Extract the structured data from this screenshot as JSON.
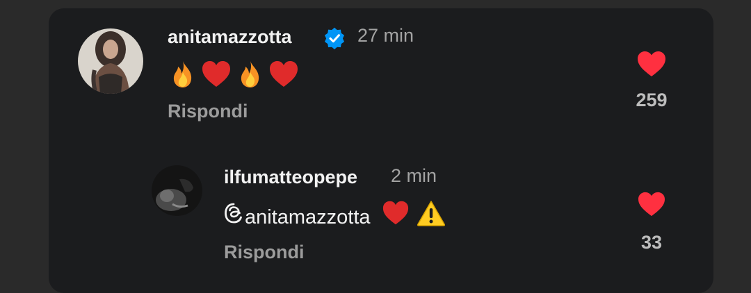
{
  "comments": [
    {
      "username": "anitamazzotta",
      "verified": true,
      "time": "27 min",
      "content_emojis": [
        "fire-emoji",
        "red-heart-emoji",
        "fire-emoji",
        "red-heart-emoji"
      ],
      "reply_label": "Rispondi",
      "like_count": "259"
    },
    {
      "username": "ilfumatteopepe",
      "verified": false,
      "time": "2 min",
      "mention": "anitamazzotta",
      "content_emojis": [
        "red-heart-emoji",
        "warning-emoji"
      ],
      "reply_label": "Rispondi",
      "like_count": "33"
    }
  ],
  "colors": {
    "background": "#2a2a2a",
    "panel": "#1b1c1e",
    "heart": "#ff3040",
    "verified": "#0095f6",
    "text_primary": "#f2f2f2",
    "text_secondary": "#a3a3a3"
  }
}
